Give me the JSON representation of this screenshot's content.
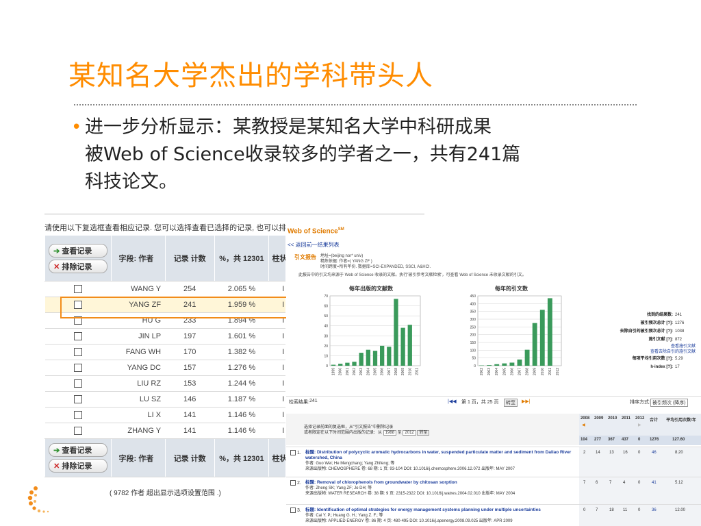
{
  "slide": {
    "title": "某知名大学杰出的学科带头人",
    "bullet_lines": [
      "进一步分析显示：某教授是某知名大学中科研成果",
      "被Web of Science收录较多的学者之一，共有241篇",
      "科技论文。"
    ]
  },
  "left_table": {
    "note": "请使用以下复选框查看相应记录. 您可以选择查看已选择的记录, 也可以排除这",
    "buttons": {
      "view": "查看记录",
      "exclude": "排除记录"
    },
    "headers": {
      "field": "字段: 作者",
      "count": "记录 计数",
      "percent": "%，共 12301",
      "bar": "柱状图"
    },
    "rows": [
      {
        "author": "WANG Y",
        "count": "254",
        "percent": "2.065 %",
        "bar": "I"
      },
      {
        "author": "YANG ZF",
        "count": "241",
        "percent": "1.959 %",
        "bar": "I"
      },
      {
        "author": "HU G",
        "count": "233",
        "percent": "1.894 %",
        "bar": "I"
      },
      {
        "author": "JIN LP",
        "count": "197",
        "percent": "1.601 %",
        "bar": "I"
      },
      {
        "author": "FANG WH",
        "count": "170",
        "percent": "1.382 %",
        "bar": "I"
      },
      {
        "author": "YANG DC",
        "count": "157",
        "percent": "1.276 %",
        "bar": "I"
      },
      {
        "author": "LIU RZ",
        "count": "153",
        "percent": "1.244 %",
        "bar": "I"
      },
      {
        "author": "LU SZ",
        "count": "146",
        "percent": "1.187 %",
        "bar": "I"
      },
      {
        "author": "LI X",
        "count": "141",
        "percent": "1.146 %",
        "bar": "I"
      },
      {
        "author": "ZHANG Y",
        "count": "141",
        "percent": "1.146 %",
        "bar": "I"
      }
    ],
    "footnote": "( 9782 作者  超出显示选项设置范围 .)"
  },
  "report": {
    "logo": "Web of Science",
    "logo_sup": "SM",
    "back_link": "<< 返回前一结果列表",
    "title": "引文报告",
    "meta_1": "地址=(beijing nor* univ)",
    "meta_2": "精炼依据: 作者=( YANG ZF )",
    "meta_3": "时间跨度=所有年份. 数据库=SCI-EXPANDED, SSCI, A&HCI.",
    "description": "此报告中的引文均来源于 Web of Science 收录的文献。执行'被引参考文献检索'，可查看 Web of Science 未收录文献的引文。",
    "chart1_title": "每年出版的文献数",
    "chart2_title": "每年的引文数",
    "stats": [
      {
        "label": "找到的结果数:",
        "value": "241"
      },
      {
        "label": "被引频次总计 [?]:",
        "value": "1276"
      },
      {
        "label": "去除自引的被引频次总计 [?]:",
        "value": "1038"
      },
      {
        "label": "施引文献 [?]:",
        "value": "872"
      },
      {
        "label": "每项平均引用次数 [?]:",
        "value": "5.29"
      },
      {
        "label": "h-index [?]:",
        "value": "17"
      }
    ],
    "stat_links": [
      "查看施引文献",
      "查看去除自引的施引文献"
    ],
    "result_label": "检索结果:",
    "result_value": "241",
    "pager": "第 1 页，共 25 页",
    "pager_go": "转至",
    "sort_label": "排序方式:",
    "sort_value": "被引频次 (降序)",
    "filter_text_1": "选择记录前面的复选框，从\"引文报告\"中删除记录",
    "filter_text_2": "或者限定在以下时间范围内出版的记录：从",
    "filter_from": "1988",
    "filter_to_label": "至",
    "filter_to": "2012",
    "filter_go": "转至",
    "year_headers": [
      "2008",
      "2009",
      "2010",
      "2011",
      "2012",
      "合计",
      "平均引用次数/年"
    ],
    "sum_values": [
      "104",
      "277",
      "367",
      "437",
      "0",
      "1276",
      "127.60"
    ],
    "records": [
      {
        "num": "1.",
        "title": "标题: Distribution of polycyclic aromatic hydrocarbons in water, suspended particulate matter and sediment from Daliao River watershed, China",
        "authors": "作者: Guo Wei; He Mengchang; Yang Zhifeng; 等",
        "source": "来源出版物: CHEMOSPHERE 卷: 68 期: 1 页: 93-104 DOI: 10.1016/j.chemosphere.2006.12.072 出版年: MAY 2007",
        "cells": [
          "2",
          "14",
          "13",
          "16",
          "0",
          "46",
          "8.20"
        ]
      },
      {
        "num": "2.",
        "title": "标题: Removal of chlorophenols from groundwater by chitosan sorption",
        "authors": "作者: Zheng SK; Yang ZF; Jo DH; 等",
        "source": "来源出版物: WATER RESEARCH 卷: 38 期: 9 页: 2315-2322 DOI: 10.1016/j.watres.2004.02.010 出版年: MAY 2004",
        "cells": [
          "7",
          "6",
          "7",
          "4",
          "0",
          "41",
          "5.12"
        ]
      },
      {
        "num": "3.",
        "title": "标题: Identification of optimal strategies for energy management systems planning under multiple uncertainties",
        "authors": "作者: Cai Y. P.; Huang G. H.; Yang Z. F.; 等",
        "source": "来源出版物: APPLIED ENERGY 卷: 86 期: 4 页: 480-495 DOI: 10.1016/j.apenergy.2008.09.025 出版年: APR 2009",
        "cells": [
          "0",
          "7",
          "18",
          "11",
          "0",
          "36",
          "12.00"
        ]
      }
    ]
  },
  "chart_data": [
    {
      "type": "bar",
      "title": "每年出版的文献数",
      "categories": [
        "1999",
        "2000",
        "2001",
        "2002",
        "2003",
        "2004",
        "2005",
        "2006",
        "2007",
        "2008",
        "2009",
        "2010",
        "2011"
      ],
      "values": [
        1,
        2,
        3,
        4,
        13,
        16,
        15,
        20,
        19,
        67,
        38,
        41,
        0
      ],
      "ylim": [
        0,
        70
      ],
      "yticks": [
        "0",
        "10",
        "20",
        "30",
        "40",
        "50",
        "60",
        "70"
      ],
      "color": "#3a9a5b",
      "grid": true
    },
    {
      "type": "bar",
      "title": "每年的引文数",
      "categories": [
        "2002",
        "2003",
        "2004",
        "2005",
        "2006",
        "2007",
        "2008",
        "2009",
        "2010",
        "2011",
        "2012"
      ],
      "values": [
        2,
        4,
        10,
        15,
        20,
        40,
        103,
        275,
        360,
        435,
        0
      ],
      "ylim": [
        0,
        450
      ],
      "yticks": [
        "0",
        "50",
        "100",
        "150",
        "200",
        "250",
        "300",
        "350",
        "400",
        "450"
      ],
      "color": "#3a9a5b",
      "grid": true
    }
  ]
}
